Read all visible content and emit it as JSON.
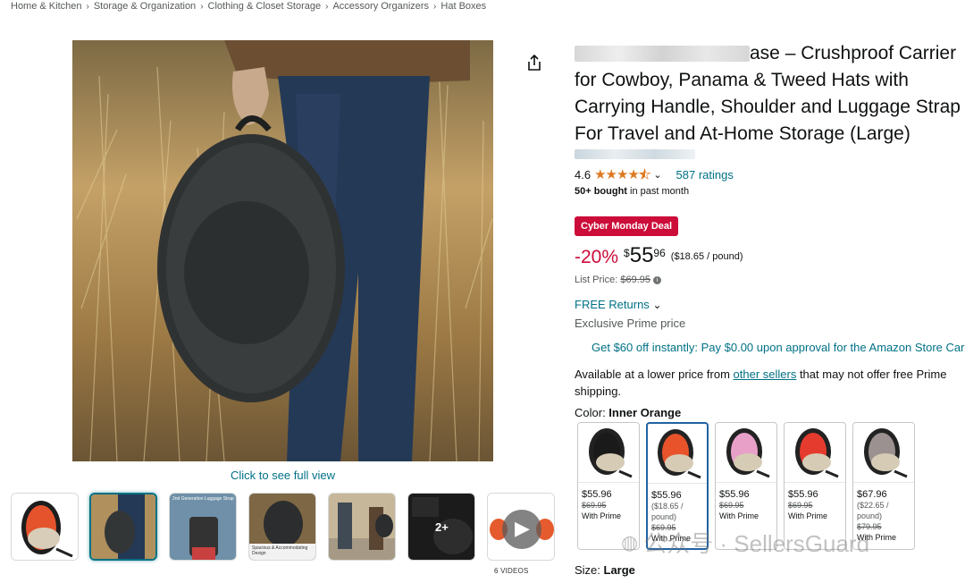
{
  "breadcrumb": [
    "Home & Kitchen",
    "Storage & Organization",
    "Clothing & Closet Storage",
    "Accessory Organizers",
    "Hat Boxes"
  ],
  "media": {
    "full_view_label": "Click to see full view",
    "videos_label": "6 VIDEOS",
    "thumb_plus_label": "2+",
    "thumb_gen_label": "2nd Generation Luggage Strap",
    "thumb_spacious_label": "Spacious & Accommodating Design"
  },
  "product": {
    "title_line1": "ase – Crushproof Carrier",
    "title_line2": "for Cowboy, Panama & Tweed Hats with",
    "title_line3": "Carrying Handle, Shoulder and Luggage Strap",
    "title_line4": "For Travel and At-Home Storage (Large)",
    "rating_value": "4.6",
    "rating_stars": 4.6,
    "ratings_count": "587 ratings",
    "bought_bold": "50+ bought",
    "bought_rest": " in past month"
  },
  "pricing": {
    "deal_badge": "Cyber Monday Deal",
    "discount": "-20%",
    "currency": "$",
    "whole": "55",
    "fraction": "96",
    "per_unit": "($18.65 / pound)",
    "list_price_label": "List Price: ",
    "list_price": "$69.95",
    "info_icon": "i"
  },
  "delivery": {
    "returns": "FREE Returns",
    "prime_price": "Exclusive Prime price",
    "card_offer": "Get $60 off instantly: Pay $0.00 upon approval for the Amazon Store Card",
    "avail_before": "Available at a lower price from ",
    "avail_link": "other sellers",
    "avail_after": " that may not offer free Prime shipping."
  },
  "color": {
    "label": "Color: ",
    "selected": "Inner Orange",
    "options": [
      {
        "price": "$55.96",
        "unit": "",
        "list": "$69.95",
        "note": "With Prime",
        "accent": "#1a1a1a"
      },
      {
        "price": "$55.96",
        "unit": "($18.65 / pound)",
        "list": "$69.95",
        "note": "With Prime",
        "accent": "#e8532b"
      },
      {
        "price": "$55.96",
        "unit": "",
        "list": "$69.95",
        "note": "With Prime",
        "accent": "#e8a0c8"
      },
      {
        "price": "$55.96",
        "unit": "",
        "list": "$69.95",
        "note": "With Prime",
        "accent": "#e53b2e"
      },
      {
        "price": "$67.96",
        "unit": "($22.65 / pound)",
        "list": "$79.95",
        "note": "With Prime",
        "accent": "#9a9190"
      }
    ]
  },
  "size": {
    "label": "Size: ",
    "value": "Large"
  },
  "watermark": {
    "text": "公众号 · SellersGuard"
  }
}
